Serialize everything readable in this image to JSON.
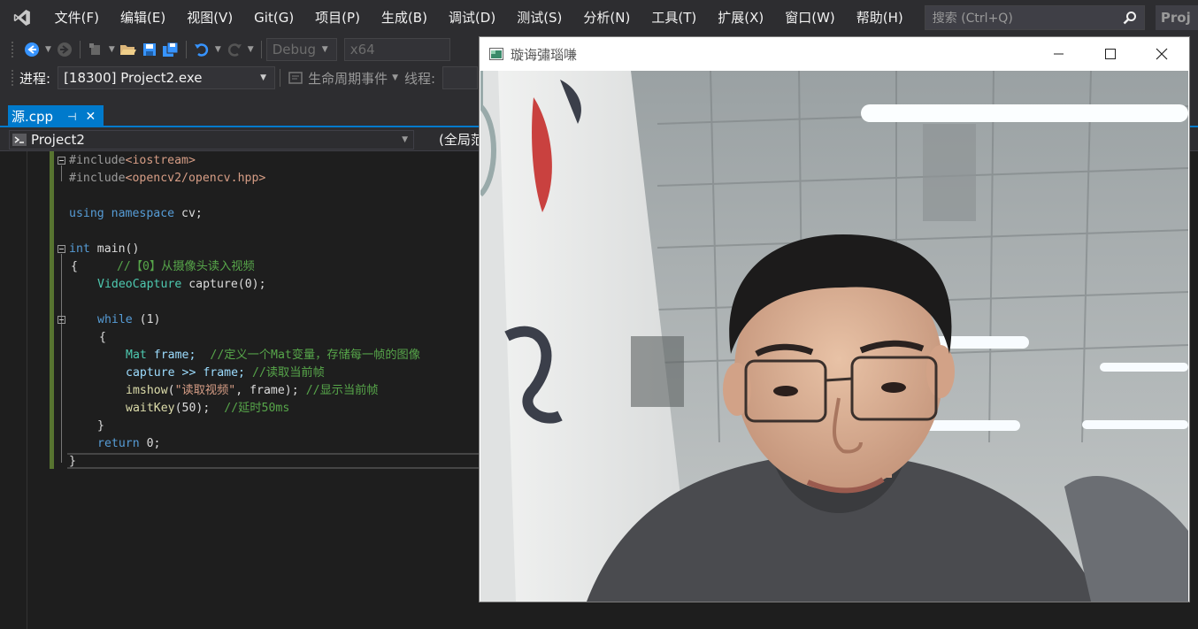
{
  "menubar": {
    "items": [
      "文件(F)",
      "编辑(E)",
      "视图(V)",
      "Git(G)",
      "项目(P)",
      "生成(B)",
      "调试(D)",
      "测试(S)",
      "分析(N)",
      "工具(T)",
      "扩展(X)",
      "窗口(W)",
      "帮助(H)"
    ],
    "search_placeholder": "搜索 (Ctrl+Q)",
    "project_tab": "Proj"
  },
  "toolbar": {
    "config": "Debug",
    "platform": "x64"
  },
  "debug_toolbar": {
    "process_label": "进程:",
    "process_value": "[18300] Project2.exe",
    "lifecycle_label": "生命周期事件",
    "thread_label": "线程:"
  },
  "document_tab": {
    "label": "源.cpp",
    "pin_icon": "pin-icon",
    "close_icon": "close-icon"
  },
  "navbar": {
    "project": "Project2",
    "scope": "(全局范"
  },
  "code": {
    "l1_pp": "#include",
    "l1_inc": "<iostream>",
    "l2_pp": "#include",
    "l2_inc": "<opencv2/opencv.hpp>",
    "l4_kw": "using namespace",
    "l4_rest": " cv;",
    "l6_kw": "int",
    "l6_rest": " main()",
    "l7_brace": "{",
    "l7_comment": "//【0】从摄像头读入视频",
    "l8_type": "VideoCapture",
    "l8_rest": " capture(0);",
    "l10_kw": "while",
    "l10_rest": " (1)",
    "l11_brace": "{",
    "l12_type": "Mat",
    "l12_var": " frame;",
    "l12_comment": "//定义一个Mat变量，存储每一帧的图像",
    "l13_code": "capture >> frame;",
    "l13_comment": "//读取当前帧",
    "l14_fn": "imshow",
    "l14_str": "\"读取视频\"",
    "l14_rest": ", frame);",
    "l14_comment": "//显示当前帧",
    "l15_fn": "waitKey",
    "l15_rest": "(50);",
    "l15_comment": "//延时50ms",
    "l16_brace": "}",
    "l17_kw": "return",
    "l17_rest": " 0;",
    "l18_brace": "}"
  },
  "opencv_window": {
    "title": "璇诲彇瑙嗛",
    "minimize_icon": "minimize-icon",
    "maximize_icon": "maximize-icon",
    "close_icon": "close-icon"
  },
  "colors": {
    "accent": "#007acc",
    "chrome": "#2d2d30",
    "editor_bg": "#1e1e1e",
    "change_bar": "#577430"
  }
}
